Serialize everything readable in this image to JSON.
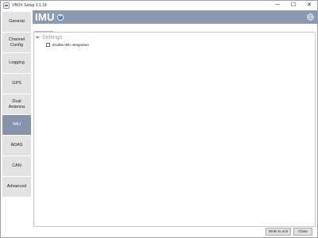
{
  "window": {
    "title": "VBOX Setup 3.1.18",
    "minimize_glyph": "─",
    "maximize_glyph": "☐",
    "close_glyph": "✕"
  },
  "sidebar": {
    "items": [
      {
        "label": "General"
      },
      {
        "label": "Channel Config"
      },
      {
        "label": "Logging"
      },
      {
        "label": "GPS"
      },
      {
        "label": "Dual Antenna"
      },
      {
        "label": "IMU",
        "active": true
      },
      {
        "label": "ADAS"
      },
      {
        "label": "CAN"
      },
      {
        "label": "Advanced"
      }
    ]
  },
  "header": {
    "title": "IMU",
    "help_glyph": "?",
    "help_icon": "help-circle-icon",
    "language_icon": "globe-icon"
  },
  "tabs": [
    {
      "label": "Settings",
      "active": true
    }
  ],
  "panel": {
    "section_title": "Settings",
    "checkbox_label": "Enable IMU integration",
    "checkbox_checked": false
  },
  "footer": {
    "write_button": "Write to unit",
    "close_button": "Close"
  },
  "colors": {
    "accent": "#8b9ab3",
    "active_nav": "#8593ad",
    "nav_bg": "#e3e3e3",
    "help_icon": "#3d72c5"
  }
}
